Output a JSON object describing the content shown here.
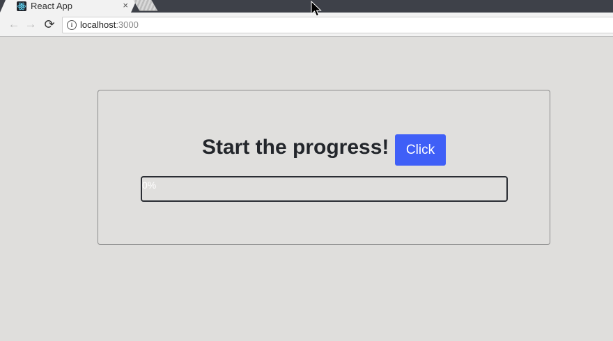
{
  "browser": {
    "tab": {
      "title": "React App",
      "close": "×",
      "favicon": "react-icon"
    },
    "nav": {
      "back": "←",
      "forward": "→",
      "reload": "⟳"
    },
    "address": {
      "host": "localhost",
      "port": ":3000",
      "info": "i"
    }
  },
  "page": {
    "headline": "Start the progress!",
    "button_label": "Click",
    "progress": {
      "value": 0,
      "label": "0%"
    },
    "colors": {
      "accent": "#3f5ff7",
      "background": "#dfdedc",
      "text": "#23262b"
    }
  }
}
